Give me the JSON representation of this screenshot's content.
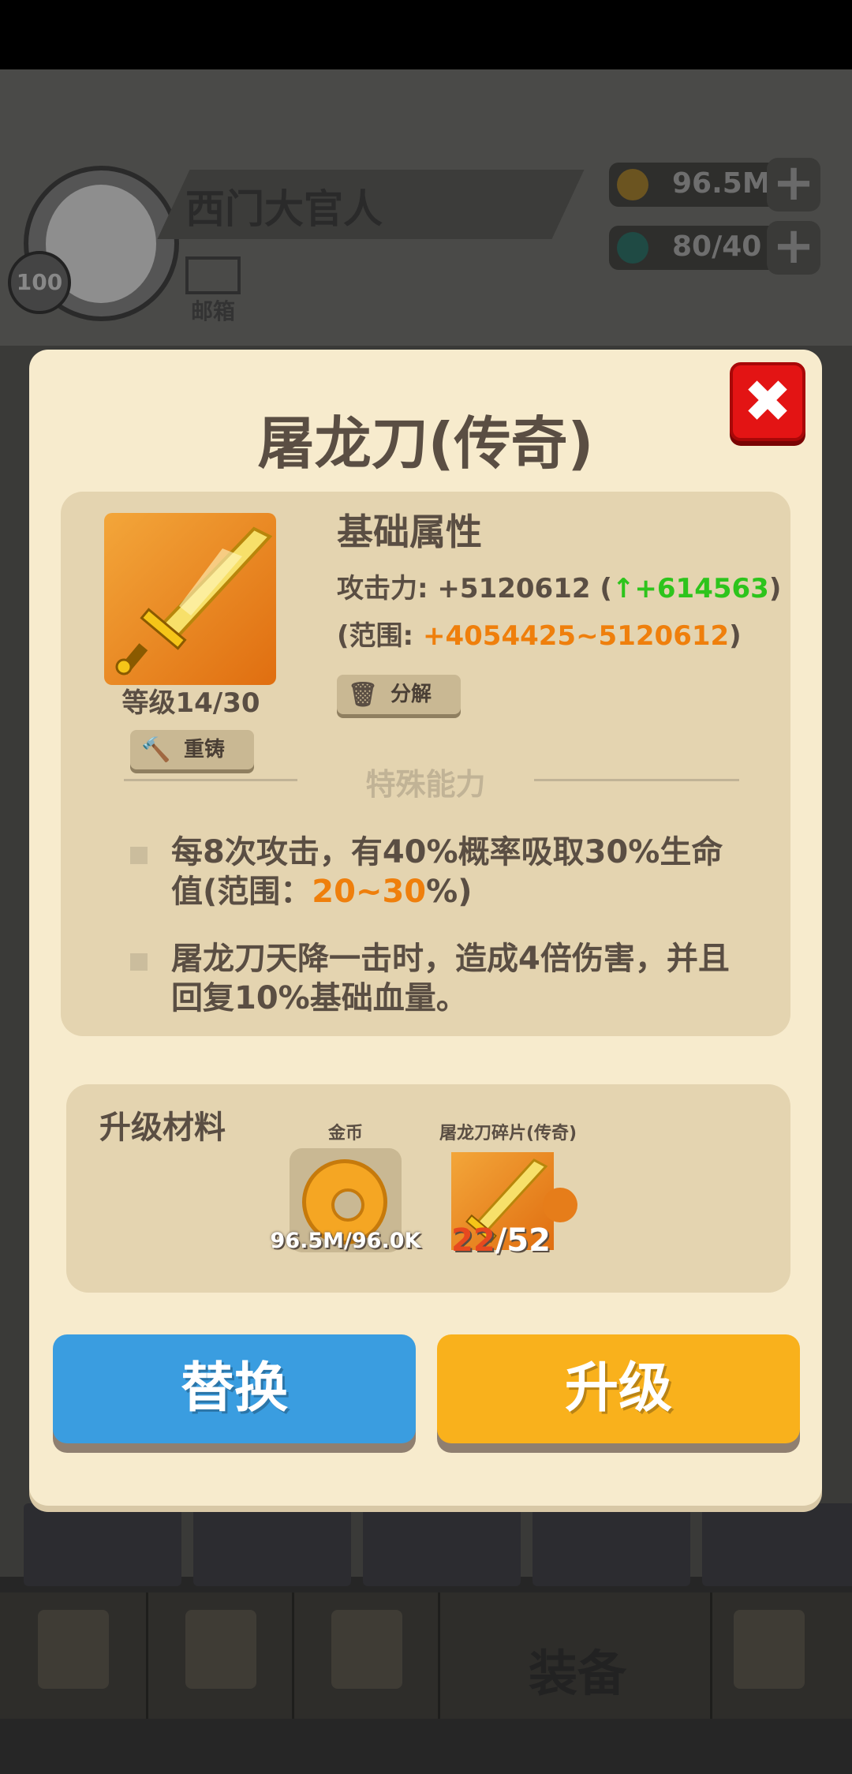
{
  "header": {
    "player_name": "西门大官人",
    "player_level": "100",
    "mail_label": "邮箱",
    "coins": "96.5M",
    "energy": "80/40",
    "plus_symbol": "+"
  },
  "bottom_nav": {
    "equip_label": "装备"
  },
  "modal": {
    "title": "屠龙刀(传奇)",
    "close_symbol": "✖",
    "level_text": "等级14/30",
    "recast_label": "重铸",
    "decompose_label": "分解",
    "base_attr_title": "基础属性",
    "attack_label": "攻击力: +5120612 (",
    "attack_arrow": "↑",
    "attack_bonus": "+614563",
    "attack_close": ")",
    "range_label": "(范围: ",
    "range_value": "+4054425~5120612",
    "range_close": ")",
    "special_title": "特殊能力",
    "ability1_part1": "每8次攻击，有40%概率吸取30%生命值(范围：",
    "ability1_highlight": "20~30",
    "ability1_part2": "%)",
    "ability2": "屠龙刀天降一击时，造成4倍伤害，并且回复10%基础血量。",
    "materials_title": "升级材料",
    "gold_name": "金币",
    "gold_count": "96.5M/96.0K",
    "fragment_name": "屠龙刀碎片(传奇)",
    "fragment_current": "22",
    "fragment_total": "/52",
    "replace_button": "替换",
    "upgrade_button": "升级"
  },
  "colors": {
    "panel_bg": "#f7ebcd",
    "inner_panel": "#e4d4b0",
    "text_brown": "#5a4e43",
    "bonus_green": "#2dc41c",
    "range_orange": "#ef7f0c",
    "close_red": "#e31414",
    "replace_blue": "#3a9de0",
    "upgrade_yellow": "#f9b11c"
  },
  "icons": [
    "sword-icon",
    "hammer-icon",
    "trash-icon",
    "close-icon",
    "coin-icon",
    "fragment-icon",
    "mail-icon",
    "gem-icon"
  ]
}
